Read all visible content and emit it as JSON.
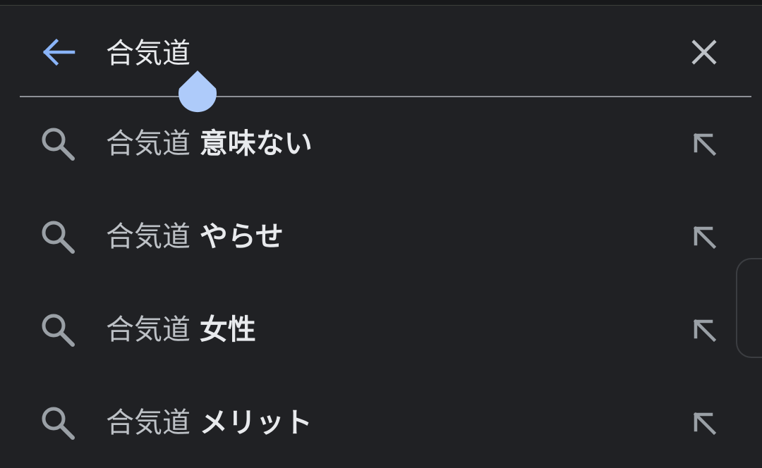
{
  "search": {
    "query": "合気道",
    "back_icon": "arrow-back-icon",
    "clear_icon": "close-icon"
  },
  "suggestions": [
    {
      "prefix": "合気道",
      "suffix": "意味ない",
      "icon": "search-icon",
      "action_icon": "arrow-up-left-icon"
    },
    {
      "prefix": "合気道",
      "suffix": "やらせ",
      "icon": "search-icon",
      "action_icon": "arrow-up-left-icon"
    },
    {
      "prefix": "合気道",
      "suffix": "女性",
      "icon": "search-icon",
      "action_icon": "arrow-up-left-icon"
    },
    {
      "prefix": "合気道",
      "suffix": "メリット",
      "icon": "search-icon",
      "action_icon": "arrow-up-left-icon"
    }
  ],
  "colors": {
    "background": "#202124",
    "accent": "#8ab4f8",
    "text_primary": "#e8eaed",
    "text_secondary": "#bdc1c6",
    "icon": "#9aa0a6",
    "divider": "#8d9096",
    "cursor_handle": "#aecbfa"
  }
}
